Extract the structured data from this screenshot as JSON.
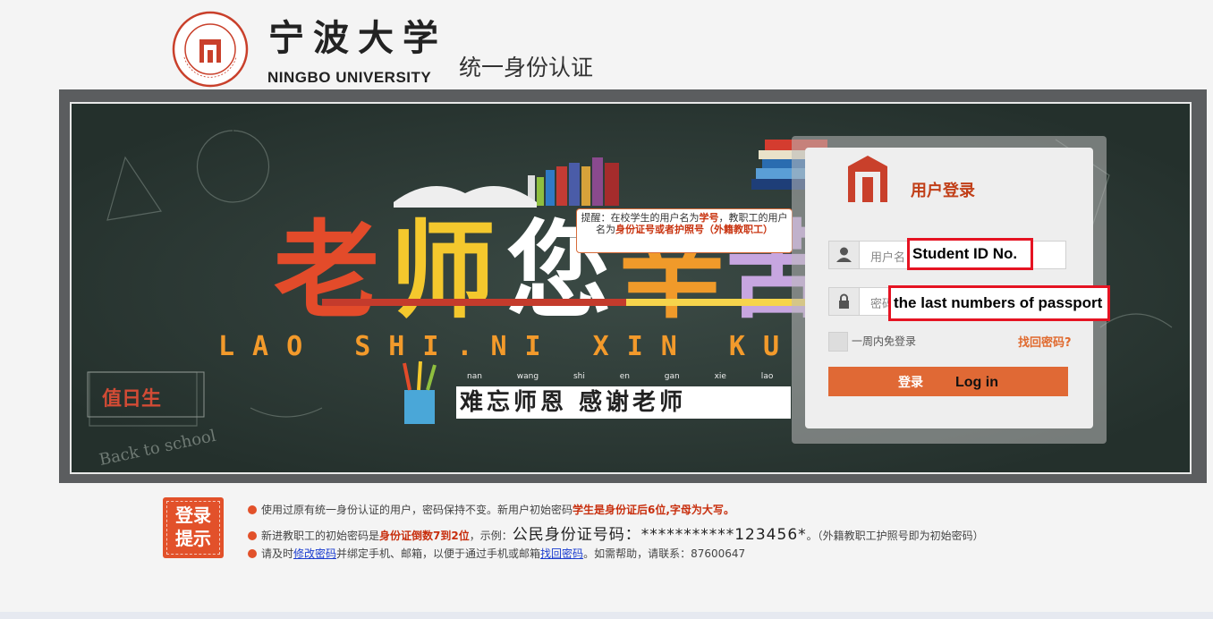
{
  "header": {
    "seal_text": "宁波大学 NINGBO UNIVERSITY",
    "logo_cn": "宁波大学",
    "logo_en": "NINGBO UNIVERSITY",
    "system_title": "统一身份认证"
  },
  "banner": {
    "big_title": "老师您辛苦了",
    "pinyin": "LAO SHI.NI XIN KU LE",
    "pinyin_small": "nan wang shi en gan xie lao shi",
    "slogan": "难忘师恩 感谢老师",
    "duty_label": "值日生",
    "tip": {
      "prefix": "提醒：在校学生的用户名为",
      "student_term": "学号",
      "middle": "，教职工的用户名为",
      "staff_term": "身份证号或者护照号（外籍教职工）"
    }
  },
  "login": {
    "title": "用户登录",
    "username_placeholder": "用户名",
    "password_placeholder": "密码",
    "annotation_username": "Student ID No.",
    "annotation_password": "the last numbers of passport",
    "remember_label": "一周内免登录",
    "forgot_label": "找回密码?",
    "login_button": "登录",
    "login_button_en": "Log in",
    "accent_color": "#e06935"
  },
  "notice": {
    "badge": "登录提示",
    "line1_prefix": "使用过原有统一身份认证的用户，密码保持不变。新用户初始密码",
    "line1_bold": "学生是身份证后6位,字母为大写",
    "line1_suffix": "。",
    "line2_prefix": "新进教职工的初始密码是",
    "line2_bold": "身份证倒数7到2位",
    "line2_mid": "，示例：",
    "line2_sample": "公民身份证号码：***********123456*",
    "line2_suffix": "。（外籍教职工护照号即为初始密码）",
    "line3_prefix": "请及时",
    "line3_link1": "修改密码",
    "line3_mid": "并绑定手机、邮箱，以便于通过手机或邮箱",
    "line3_link2": "找回密码",
    "line3_suffix": "。如需帮助，请联系：87600647"
  }
}
